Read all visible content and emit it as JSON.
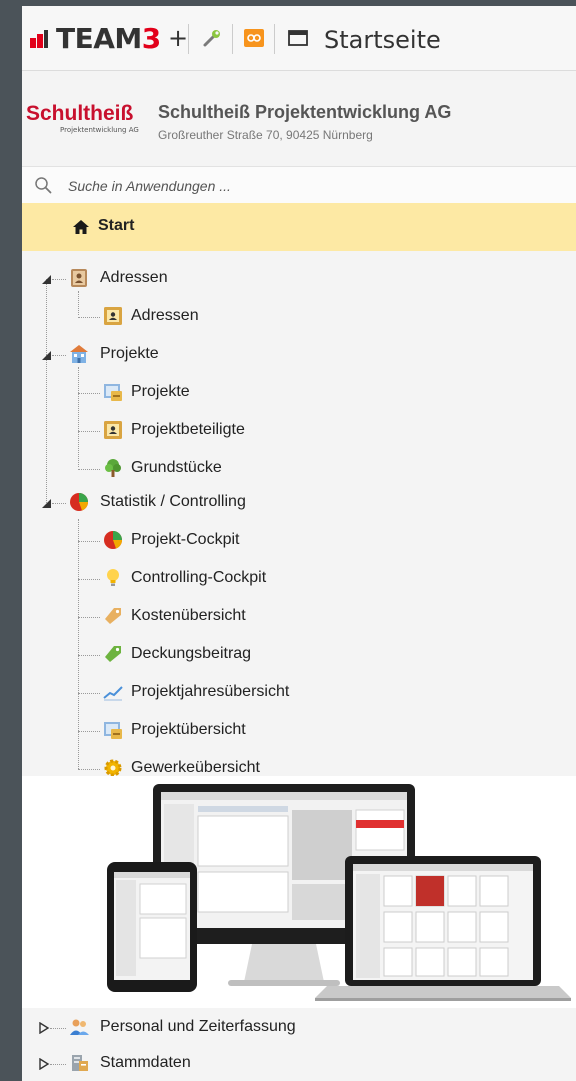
{
  "titlebar": {
    "logo_prefix": "TEAM",
    "logo_number": "3",
    "logo_plus": "+",
    "wrench_icon": "wrench-icon",
    "chat_icon": "chat-icon",
    "window_icon": "window-icon",
    "page_title": "Startseite"
  },
  "company": {
    "brand": "Schultheiß",
    "brand_sub": "Projektentwicklung AG",
    "name": "Schultheiß Projektentwicklung AG",
    "address": "Großreuther Straße 70, 90425 Nürnberg"
  },
  "search": {
    "placeholder": "Suche in Anwendungen ..."
  },
  "start": {
    "label": "Start",
    "icon": "home-icon"
  },
  "tree": {
    "groups": [
      {
        "label": "Adressen",
        "icon": "address-book-icon",
        "expanded": true,
        "items": [
          {
            "label": "Adressen",
            "icon": "contact-card-icon"
          }
        ]
      },
      {
        "label": "Projekte",
        "icon": "building-icon",
        "expanded": true,
        "items": [
          {
            "label": "Projekte",
            "icon": "project-icon"
          },
          {
            "label": "Projektbeteiligte",
            "icon": "contact-card-icon"
          },
          {
            "label": "Grundstücke",
            "icon": "tree-icon"
          }
        ]
      },
      {
        "label": "Statistik / Controlling",
        "icon": "pie-chart-icon",
        "expanded": true,
        "items": [
          {
            "label": "Projekt-Cockpit",
            "icon": "pie-chart-icon"
          },
          {
            "label": "Controlling-Cockpit",
            "icon": "lightbulb-icon"
          },
          {
            "label": "Kostenübersicht",
            "icon": "tag-icon"
          },
          {
            "label": "Deckungsbeitrag",
            "icon": "tag-green-icon"
          },
          {
            "label": "Projektjahresübersicht",
            "icon": "line-chart-icon"
          },
          {
            "label": "Projektübersicht",
            "icon": "project-icon"
          },
          {
            "label": "Gewerkeübersicht",
            "icon": "gear-icon"
          }
        ]
      }
    ],
    "collapsed_groups": [
      {
        "label": "Personal und Zeiterfassung",
        "icon": "people-icon",
        "expanded": false
      },
      {
        "label": "Stammdaten",
        "icon": "database-icon",
        "expanded": false
      }
    ]
  },
  "illustration": {
    "icon": "devices-illustration"
  },
  "colors": {
    "brand_red": "#e2001a",
    "start_highlight": "#fde9a4",
    "frame": "#4b5359"
  }
}
